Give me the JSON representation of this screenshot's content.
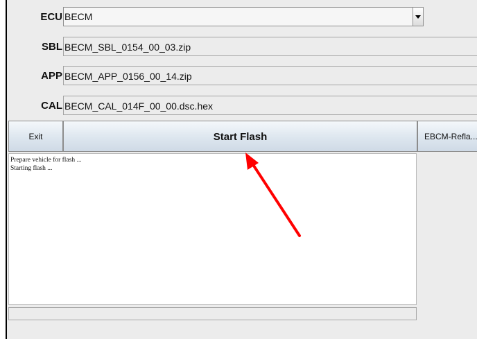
{
  "form": {
    "ecu": {
      "label": "ECU",
      "value": "BECM"
    },
    "sbl": {
      "label": "SBL",
      "value": "BECM_SBL_0154_00_03.zip"
    },
    "app": {
      "label": "APP",
      "value": "BECM_APP_0156_00_14.zip"
    },
    "cal": {
      "label": "CAL",
      "value": "BECM_CAL_014F_00_00.dsc.hex"
    }
  },
  "buttons": {
    "exit": "Exit",
    "start_flash": "Start Flash",
    "reflash": "EBCM-Refla..."
  },
  "log": {
    "lines": [
      "Prepare vehicle for flash ...",
      "Starting flash ..."
    ]
  },
  "progress": {
    "value": 0
  },
  "annotation": {
    "arrow_color": "#ff0000"
  },
  "icons": {
    "combo_arrow": "chevron-down-icon"
  }
}
